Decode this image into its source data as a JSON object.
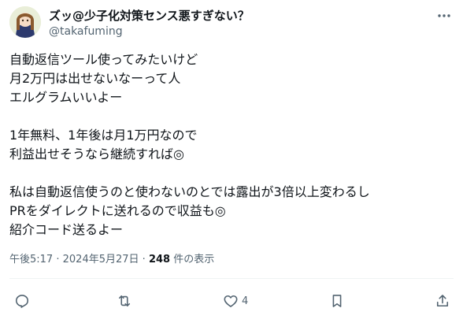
{
  "author": {
    "display_name": "ズッ@少子化対策センス悪すぎない？",
    "handle": "@takafuming"
  },
  "tweet": {
    "lines": [
      "自動返信ツール使ってみたいけど",
      "月2万円は出せないなーって人",
      "エルグラムいいよー",
      "",
      "1年無料、1年後は月1万円なので",
      "利益出せそうなら継続すれば◎",
      "",
      "私は自動返信使うのと使わないのとでは露出が3倍以上変わるし",
      "PRをダイレクトに送れるので収益も◎",
      "紹介コード送るよー"
    ]
  },
  "meta": {
    "time": "午後5:17",
    "separator": "·",
    "date": "2024年5月27日",
    "views_count": "248",
    "views_label": "件の表示"
  },
  "actions": {
    "reply_count": "",
    "retweet_count": "",
    "like_count": "4"
  },
  "colors": {
    "text": "#0f1419",
    "secondary": "#536471",
    "divider": "#eff3f4"
  },
  "icons": [
    "avatar",
    "more-icon",
    "reply-icon",
    "retweet-icon",
    "like-icon",
    "bookmark-icon",
    "share-icon"
  ]
}
